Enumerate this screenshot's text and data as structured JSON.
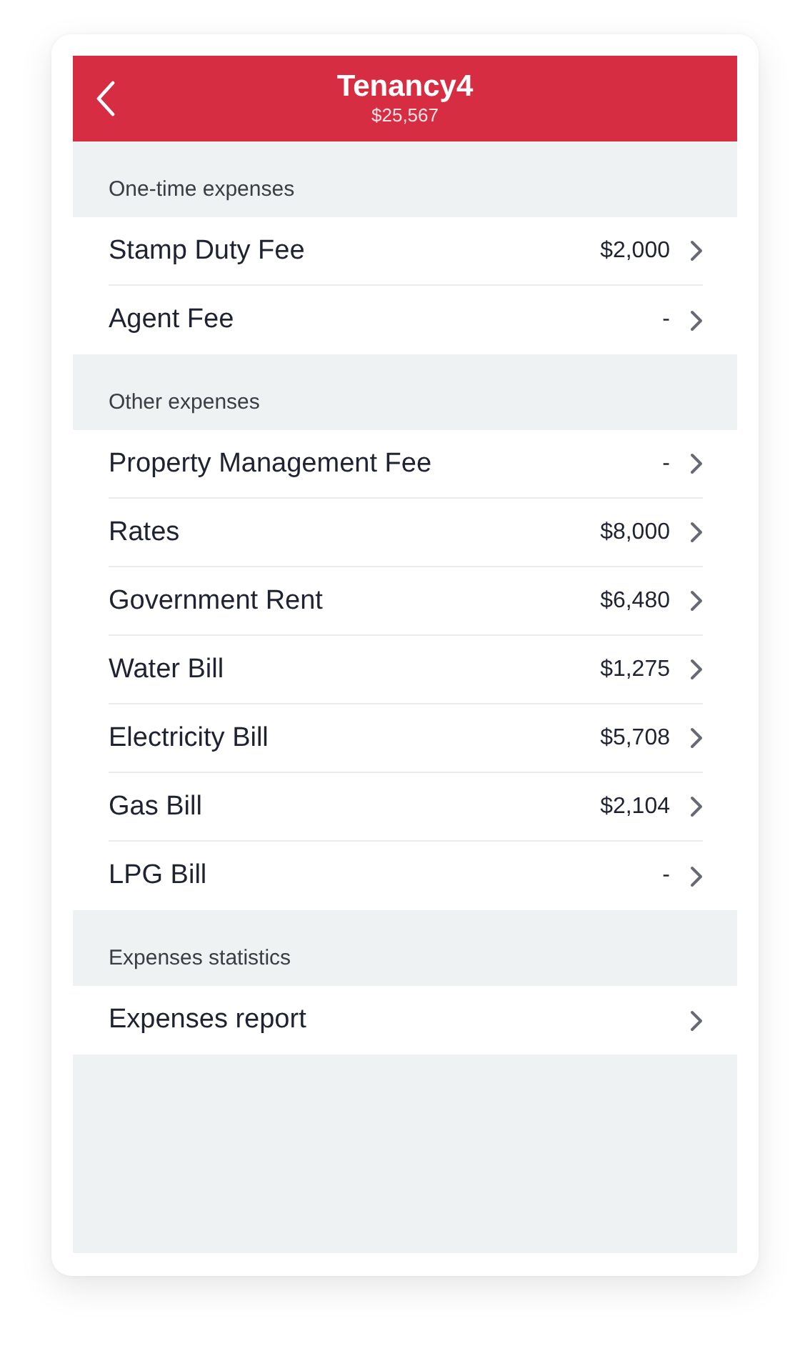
{
  "header": {
    "title": "Tenancy4",
    "subtitle": "$25,567"
  },
  "sections": [
    {
      "title": "One-time expenses",
      "items": [
        {
          "label": "Stamp Duty Fee",
          "value": "$2,000"
        },
        {
          "label": "Agent Fee",
          "value": "-"
        }
      ]
    },
    {
      "title": "Other expenses",
      "items": [
        {
          "label": "Property Management Fee",
          "value": "-"
        },
        {
          "label": "Rates",
          "value": "$8,000"
        },
        {
          "label": "Government Rent",
          "value": "$6,480"
        },
        {
          "label": "Water Bill",
          "value": "$1,275"
        },
        {
          "label": "Electricity Bill",
          "value": "$5,708"
        },
        {
          "label": "Gas Bill",
          "value": "$2,104"
        },
        {
          "label": "LPG Bill",
          "value": "-"
        }
      ]
    },
    {
      "title": "Expenses statistics",
      "items": [
        {
          "label": "Expenses report"
        }
      ]
    }
  ]
}
